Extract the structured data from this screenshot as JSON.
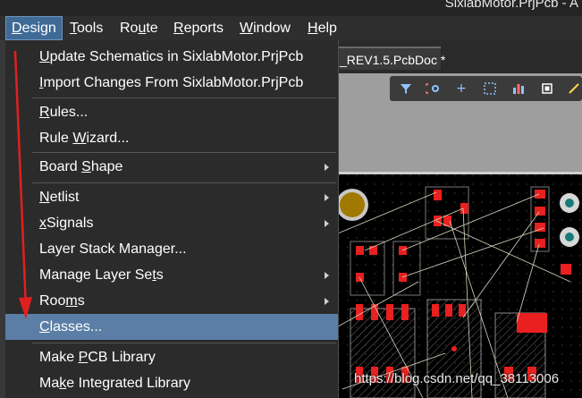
{
  "window": {
    "title": "SixlabMotor.PrjPcb - A"
  },
  "menubar": {
    "items": [
      {
        "id": "design",
        "label": "Design",
        "mnemonic": "D",
        "active": true
      },
      {
        "id": "tools",
        "label": "Tools",
        "mnemonic": "T"
      },
      {
        "id": "route",
        "label": "Route",
        "mnemonic": "u"
      },
      {
        "id": "reports",
        "label": "Reports",
        "mnemonic": "R"
      },
      {
        "id": "window",
        "label": "Window",
        "mnemonic": "W"
      },
      {
        "id": "help",
        "label": "Help",
        "mnemonic": "H"
      }
    ]
  },
  "document_tab": {
    "label": "_REV1.5.PcbDoc *"
  },
  "design_menu": {
    "items": [
      {
        "label": "Update Schematics in SixlabMotor.PrjPcb",
        "mnemonic": "U",
        "submenu": false
      },
      {
        "label": "Import Changes From SixlabMotor.PrjPcb",
        "mnemonic": "I",
        "submenu": false
      },
      {
        "label": "Rules...",
        "mnemonic": "R",
        "submenu": false
      },
      {
        "label": "Rule Wizard...",
        "mnemonic": "W",
        "submenu": false
      },
      {
        "label": "Board Shape",
        "mnemonic": "S",
        "submenu": true
      },
      {
        "label": "Netlist",
        "mnemonic": "N",
        "submenu": true
      },
      {
        "label": "xSignals",
        "mnemonic": "x",
        "submenu": true
      },
      {
        "label": "Layer Stack Manager...",
        "mnemonic": "",
        "submenu": false
      },
      {
        "label": "Manage Layer Sets",
        "mnemonic": "t",
        "submenu": true
      },
      {
        "label": "Rooms",
        "mnemonic": "m",
        "submenu": true
      },
      {
        "label": "Classes...",
        "mnemonic": "C",
        "submenu": false,
        "highlighted": true
      },
      {
        "label": "Make PCB Library",
        "mnemonic": "P",
        "submenu": false
      },
      {
        "label": "Make Integrated Library",
        "mnemonic": "k",
        "submenu": false
      }
    ]
  },
  "pcb_toolbar": {
    "icons": [
      "filter-icon",
      "interactive-route-icon",
      "add-icon",
      "select-rect-icon",
      "chart-bars-icon",
      "component-icon",
      "line-icon"
    ]
  },
  "watermark": "https://blog.csdn.net/qq_38113006",
  "colors": {
    "menu_highlight": "#5a7ea6",
    "menubar_active": "#3f6a96",
    "pad_red": "#e8201f",
    "annotation_arrow": "#e02020"
  }
}
